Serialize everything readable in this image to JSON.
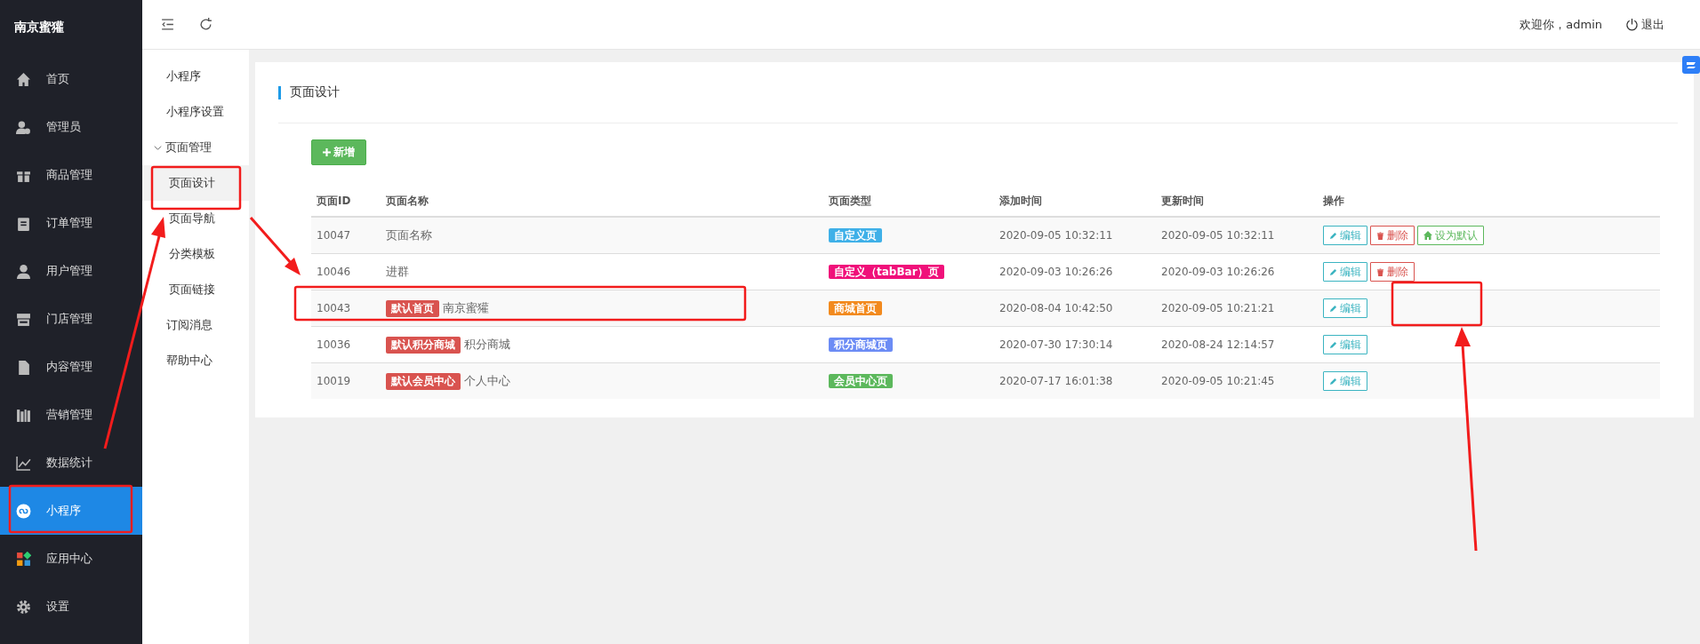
{
  "brand": "南京蜜獾",
  "sidebar": {
    "items": [
      {
        "label": "首页",
        "selected": false
      },
      {
        "label": "管理员",
        "selected": false
      },
      {
        "label": "商品管理",
        "selected": false
      },
      {
        "label": "订单管理",
        "selected": false
      },
      {
        "label": "用户管理",
        "selected": false
      },
      {
        "label": "门店管理",
        "selected": false
      },
      {
        "label": "内容管理",
        "selected": false
      },
      {
        "label": "营销管理",
        "selected": false
      },
      {
        "label": "数据统计",
        "selected": false
      },
      {
        "label": "小程序",
        "selected": true
      },
      {
        "label": "应用中心",
        "selected": false
      },
      {
        "label": "设置",
        "selected": false
      }
    ]
  },
  "top_bar": {
    "welcome": "欢迎你，admin",
    "logout": "退出"
  },
  "submenu": {
    "items": [
      {
        "label": "小程序",
        "selected": false
      },
      {
        "label": "小程序设置",
        "selected": false
      },
      {
        "label": "页面管理",
        "selected": false,
        "expanded": true,
        "children": [
          {
            "label": "页面设计",
            "selected": true
          },
          {
            "label": "页面导航",
            "selected": false
          },
          {
            "label": "分类模板",
            "selected": false
          },
          {
            "label": "页面链接",
            "selected": false
          }
        ]
      },
      {
        "label": "订阅消息",
        "selected": false
      },
      {
        "label": "帮助中心",
        "selected": false
      }
    ]
  },
  "panel": {
    "title": "页面设计",
    "add_button": "新增",
    "table": {
      "columns": [
        "页面ID",
        "页面名称",
        "页面类型",
        "添加时间",
        "更新时间",
        "操作"
      ],
      "rows": [
        {
          "id": "10047",
          "name": "页面名称",
          "type": "自定义页",
          "color": "#3fb0e8",
          "added": "2020-09-05 10:32:11",
          "updated": "2020-09-05 10:32:11",
          "actions": [
            {
              "kind": "edit",
              "label": "编辑"
            },
            {
              "kind": "delete",
              "label": "删除"
            },
            {
              "kind": "default",
              "label": "设为默认"
            }
          ]
        },
        {
          "id": "10046",
          "name": "进群",
          "type": "自定义（tabBar）页",
          "color": "#f0107a",
          "added": "2020-09-03 10:26:26",
          "updated": "2020-09-03 10:26:26",
          "actions": [
            {
              "kind": "edit",
              "label": "编辑"
            },
            {
              "kind": "delete",
              "label": "删除"
            }
          ]
        },
        {
          "id": "10043",
          "badge": "默认首页",
          "name": "南京蜜獾",
          "type": "商城首页",
          "color": "#f28a1e",
          "added": "2020-08-04 10:42:50",
          "updated": "2020-09-05 10:21:21",
          "actions": [
            {
              "kind": "edit",
              "label": "编辑"
            }
          ]
        },
        {
          "id": "10036",
          "badge": "默认积分商城",
          "name": "积分商城",
          "type": "积分商城页",
          "color": "#6c8cf5",
          "added": "2020-07-30 17:30:14",
          "updated": "2020-08-24 12:14:57",
          "actions": [
            {
              "kind": "edit",
              "label": "编辑"
            }
          ]
        },
        {
          "id": "10019",
          "badge": "默认会员中心",
          "name": "个人中心",
          "type": "会员中心页",
          "color": "#5cb85c",
          "added": "2020-07-17 16:01:38",
          "updated": "2020-09-05 10:21:45",
          "actions": [
            {
              "kind": "edit",
              "label": "编辑"
            }
          ]
        }
      ]
    }
  }
}
